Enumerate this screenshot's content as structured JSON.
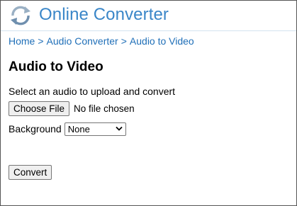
{
  "header": {
    "title": "Online Converter",
    "logo_icon": "refresh-arrows-icon"
  },
  "breadcrumb": {
    "items": [
      "Home",
      "Audio Converter",
      "Audio to Video"
    ],
    "separator": ">"
  },
  "page": {
    "title": "Audio to Video",
    "upload_label": "Select an audio to upload and convert",
    "choose_file_label": "Choose File",
    "file_status": "No file chosen",
    "background_label": "Background",
    "background_selected": "None",
    "convert_label": "Convert"
  },
  "colors": {
    "brand": "#3a86c8",
    "link": "#1f6fb8"
  }
}
